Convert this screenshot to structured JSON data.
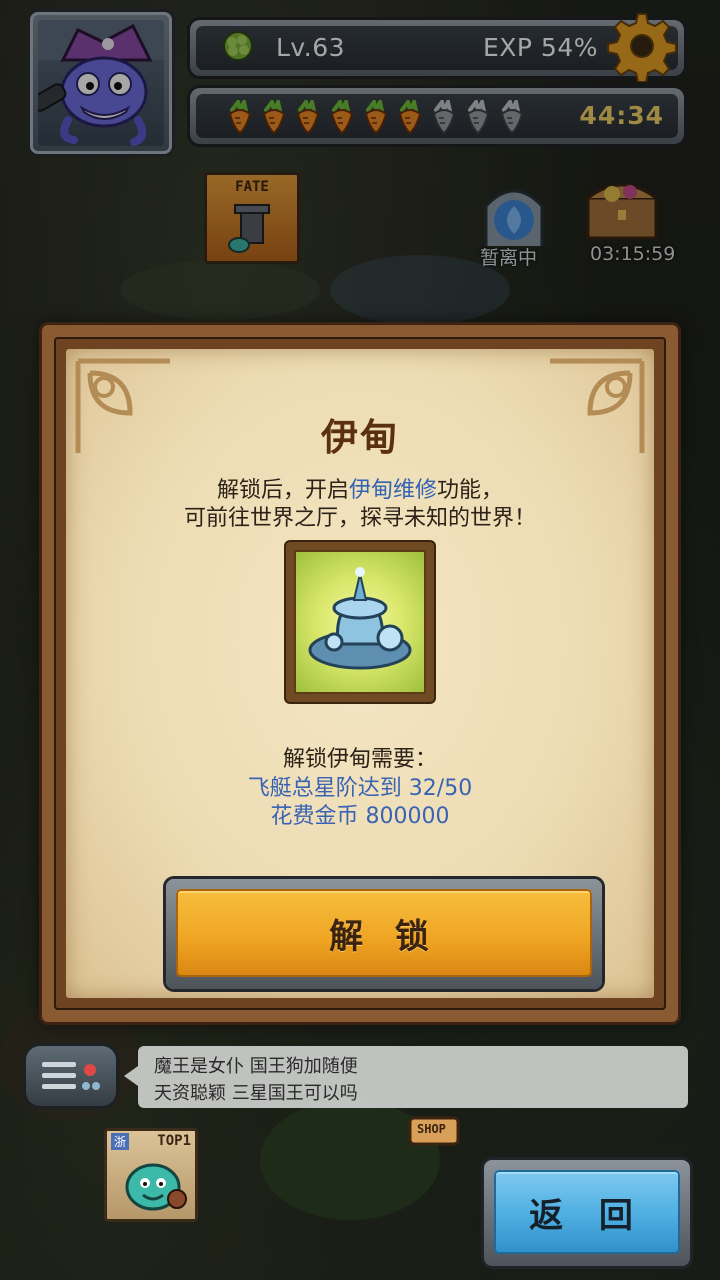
{
  "hud": {
    "level": "Lv.63",
    "exp": "EXP 54%",
    "energy_timer": "44:34",
    "energy": {
      "filled": 6,
      "total": 9
    }
  },
  "map": {
    "fate_label": "FATE",
    "portal_label": "暂离中",
    "chest_timer": "03:15:59",
    "top_badge_region": "浙",
    "top_badge_label": "TOP1",
    "shop_label": "SHOP"
  },
  "dialog": {
    "title": "伊甸",
    "desc_prefix": "解锁后，开启",
    "desc_highlight": "伊甸维修",
    "desc_suffix": "功能，",
    "desc_line2": "可前往世界之厅，探寻未知的世界！",
    "req_title": "解锁伊甸需要：",
    "req_lines": [
      "飞艇总星阶达到 32/50",
      "花费金币 800000"
    ],
    "unlock_button": "解 锁"
  },
  "chat": {
    "lines": [
      "魔王是女仆  国王狗加随便",
      "天资聪颖  三星国王可以吗"
    ]
  },
  "back_button": "返 回",
  "colors": {
    "highlight": "#3363b4",
    "unlock_button": "#f0a624",
    "back_button": "#4eaee2",
    "timer": "#f3d36a"
  }
}
